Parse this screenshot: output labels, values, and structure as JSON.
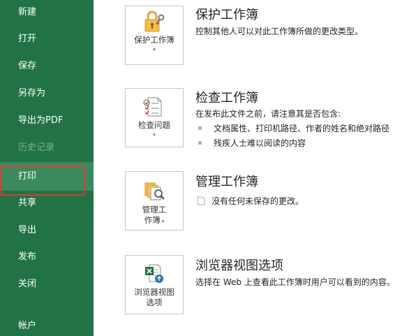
{
  "sidebar": {
    "items": [
      {
        "label": "新建"
      },
      {
        "label": "打开"
      },
      {
        "label": "保存"
      },
      {
        "label": "另存为"
      },
      {
        "label": "导出为PDF"
      },
      {
        "label": "历史记录"
      },
      {
        "label": "打印"
      },
      {
        "label": "共享"
      },
      {
        "label": "导出"
      },
      {
        "label": "发布"
      },
      {
        "label": "关闭"
      },
      {
        "label": "帐户"
      }
    ],
    "bg_color": "#217346",
    "highlight_color": "#e03a2f"
  },
  "sections": {
    "protect": {
      "tile_label": "保护工作簿",
      "title": "保护工作簿",
      "desc": "控制其他人可以对此工作簿所做的更改类型。",
      "icon": "lock-key-icon"
    },
    "inspect": {
      "tile_label": "检查问题",
      "title": "检查工作簿",
      "desc": "在发布此文件之前，请注意其是否包含:",
      "bullets": [
        "文档属性、打印机路径、作者的姓名和绝对路径",
        "残疾人士难以阅读的内容"
      ],
      "icon": "checklist-icon"
    },
    "manage": {
      "tile_label_line1": "管理工",
      "tile_label_line2": "作簿",
      "title": "管理工作簿",
      "desc": "没有任何未保存的更改。",
      "icon": "manage-workbook-icon"
    },
    "browser": {
      "tile_label_line1": "浏览器视图",
      "tile_label_line2": "选项",
      "title": "浏览器视图选项",
      "desc": "选择在 Web 上查看此工作簿时用户可以看到的内容。",
      "icon": "excel-browser-icon"
    }
  },
  "caret_glyph": "▾"
}
